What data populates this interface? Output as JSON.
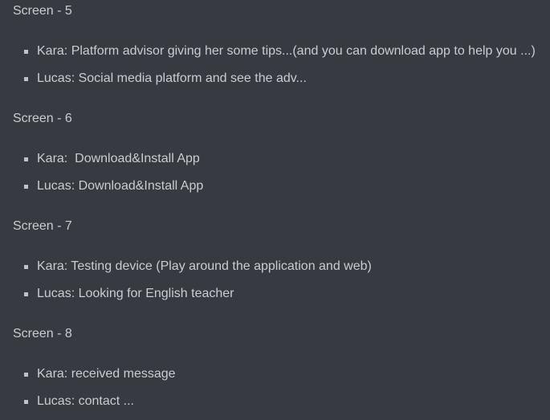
{
  "sections": [
    {
      "heading": "Screen - 5",
      "items": [
        "Kara: Platform advisor giving her some tips...(and you can download app to help you ...)",
        "Lucas: Social media platform and see the adv..."
      ]
    },
    {
      "heading": "Screen - 6",
      "items": [
        "Kara:  Download&Install App",
        "Lucas: Download&Install App"
      ]
    },
    {
      "heading": "Screen - 7",
      "items": [
        "Kara: Testing device (Play around the application and web)",
        "Lucas: Looking for English teacher"
      ]
    },
    {
      "heading": "Screen - 8",
      "items": [
        "Kara: received message",
        "Lucas: contact ..."
      ]
    }
  ]
}
